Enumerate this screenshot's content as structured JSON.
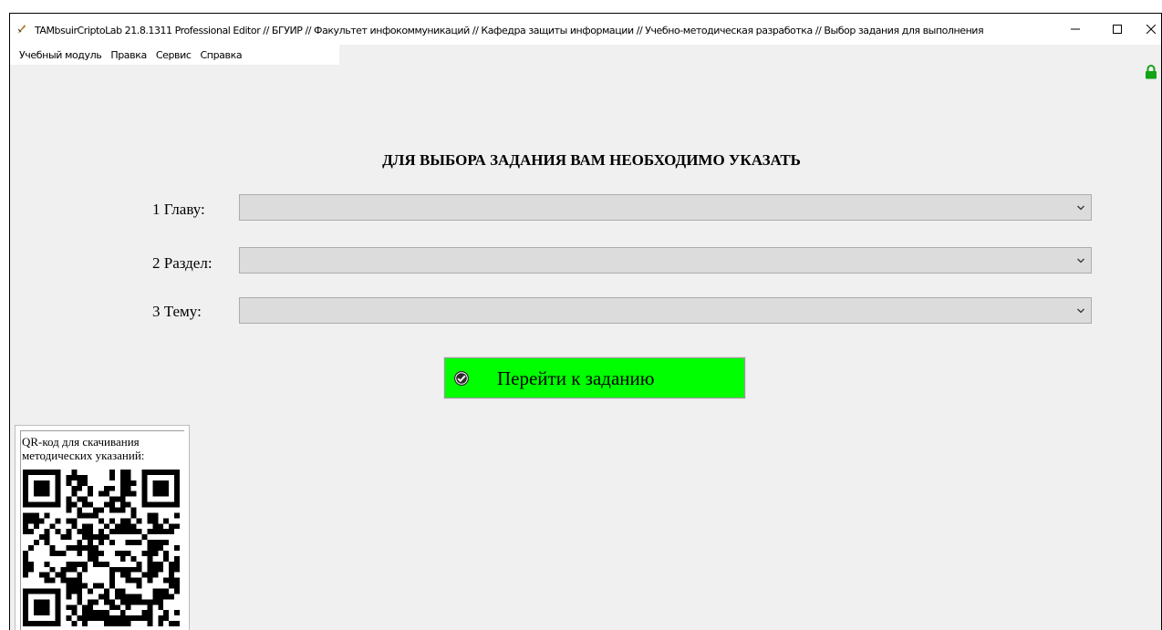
{
  "window": {
    "title": "TAMbsuirCriptoLab 21.8.1311 Professional Editor // БГУИР // Факультет инфокоммуникаций // Кафедра защиты информации // Учебно-методическая разработка // Выбор задания для выполнения",
    "app_icon": "dagger-icon",
    "controls": {
      "minimize": "minimize-icon",
      "maximize": "maximize-icon",
      "close": "close-icon"
    }
  },
  "menu": {
    "items": [
      {
        "label": "Учебный модуль"
      },
      {
        "label": "Правка"
      },
      {
        "label": "Сервис"
      },
      {
        "label": "Справка"
      }
    ]
  },
  "status": {
    "lock_icon": "lock-icon",
    "lock_color": "#14a314"
  },
  "form": {
    "heading": "ДЛЯ ВЫБОРА ЗАДАНИЯ ВАМ НЕОБХОДИМО УКАЗАТЬ",
    "fields": [
      {
        "label": "1 Главу:",
        "value": ""
      },
      {
        "label": "2 Раздел:",
        "value": ""
      },
      {
        "label": "3 Тему:",
        "value": ""
      }
    ],
    "submit": {
      "label": "Перейти к заданию",
      "icon": "check-circle-icon",
      "color": "#00ff00"
    }
  },
  "qr": {
    "caption": "QR-код для скачивания методических указаний:",
    "icon": "qr-code-icon"
  },
  "colors": {
    "window_bg": "#f0f0f0",
    "select_bg": "#dcdcdc",
    "watermark": "#e8e8e8"
  }
}
